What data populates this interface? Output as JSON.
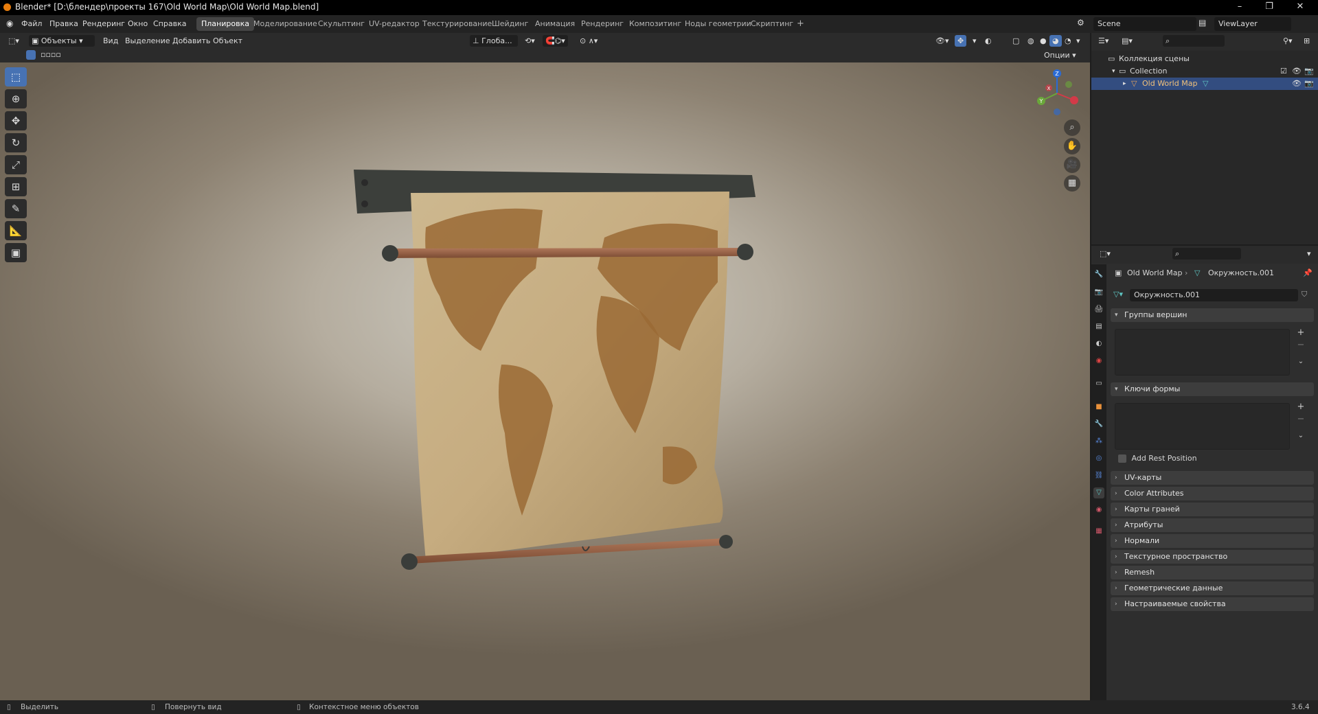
{
  "app": {
    "title": "Blender* [D:\\блендер\\проекты 167\\Old World Map\\Old World Map.blend]",
    "version": "3.6.4"
  },
  "colors": {
    "accent": "#4772b3",
    "selection": "#334d80",
    "bg": "#1d1d1d",
    "panel": "#3d3d3d",
    "logo": "#e87d0d"
  },
  "menu": [
    "Файл",
    "Правка",
    "Рендеринг",
    "Окно",
    "Справка"
  ],
  "workspaces": [
    "Планировка",
    "Моделирование",
    "Скульптинг",
    "UV-редактор",
    "Текстурирование",
    "Шейдинг",
    "Анимация",
    "Рендеринг",
    "Композитинг",
    "Ноды геометрии",
    "Скриптинг"
  ],
  "active_workspace": "Планировка",
  "scene": "Scene",
  "view_layer": "ViewLayer",
  "viewport_header": {
    "mode": "Объекты",
    "menus": [
      "Вид",
      "Выделение",
      "Добавить",
      "Объект"
    ],
    "orientation": "Глоба...",
    "options": "Опции"
  },
  "gizmo": {
    "x": "X",
    "y": "Y",
    "z": "Z"
  },
  "outliner": {
    "scene_collection": "Коллекция сцены",
    "collection": "Collection",
    "object": "Old World Map"
  },
  "properties": {
    "breadcrumb_object": "Old World Map",
    "breadcrumb_mesh": "Окружность.001",
    "mesh_name": "Окружность.001",
    "vertex_groups": "Группы вершин",
    "shape_keys": "Ключи формы",
    "add_rest_position": "Add Rest Position",
    "panels": [
      "UV-карты",
      "Color Attributes",
      "Карты граней",
      "Атрибуты",
      "Нормали",
      "Текстурное пространство",
      "Remesh",
      "Геометрические данные",
      "Настраиваемые свойства"
    ]
  },
  "status": {
    "left": "Выделить",
    "middle": "Повернуть вид",
    "right": "Контекстное меню объектов"
  }
}
